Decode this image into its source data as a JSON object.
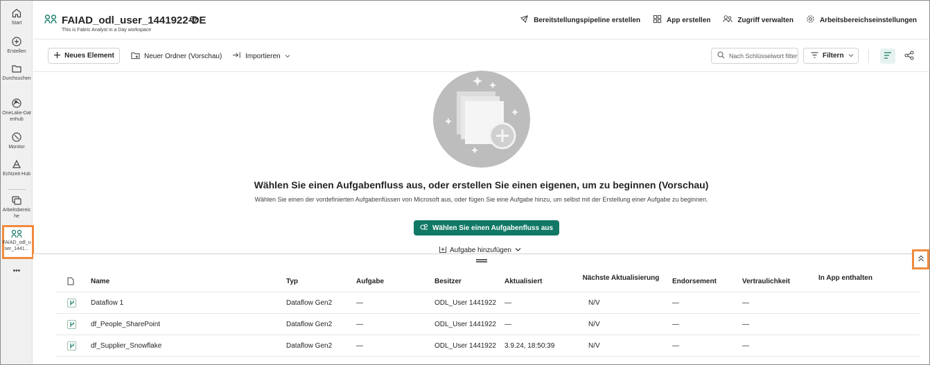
{
  "rail": {
    "items": [
      {
        "label": "Start",
        "icon": "home-icon"
      },
      {
        "label": "Erstellen",
        "icon": "create-icon"
      },
      {
        "label": "Durchsuchen",
        "icon": "folder-icon"
      },
      {
        "label": "OneLake-Datenhub",
        "icon": "onelake-icon"
      },
      {
        "label": "Monitor",
        "icon": "monitor-icon"
      },
      {
        "label": "Echtzeit-Hub",
        "icon": "realtime-icon"
      },
      {
        "label": "Arbeitsbereiche",
        "icon": "workspaces-icon"
      },
      {
        "label": "FAIAD_odl_user_1441...",
        "icon": "workspace-icon"
      }
    ],
    "more_label": "•••"
  },
  "header": {
    "title": "FAIAD_odl_user_1441922-DE",
    "subtitle": "This is Fabric Analyst in a Day workspace",
    "actions": [
      {
        "label": "Bereitstellungspipeline erstellen",
        "icon": "rocket-icon"
      },
      {
        "label": "App erstellen",
        "icon": "app-icon"
      },
      {
        "label": "Zugriff verwalten",
        "icon": "people-icon"
      },
      {
        "label": "Arbeitsbereichseinstellungen",
        "icon": "gear-icon"
      }
    ]
  },
  "toolbar": {
    "new_item": "Neues Element",
    "new_folder": "Neuer Ordner (Vorschau)",
    "import": "Importieren",
    "search_placeholder": "Nach Schlüsselwort filtern",
    "filter": "Filtern"
  },
  "empty_state": {
    "title": "Wählen Sie einen Aufgabenfluss aus, oder erstellen Sie einen eigenen, um zu beginnen (Vorschau)",
    "description": "Wählen Sie einen der vordefinierten Aufgabenfüssen von Microsoft aus, oder fügen Sie eine Aufgabe hinzu, um selbst mit der Erstellung einer Aufgabe zu beginnen.",
    "primary_button": "Wählen Sie einen Aufgabenfluss aus",
    "add_task": "Aufgabe hinzufügen"
  },
  "table": {
    "headers": {
      "name": "Name",
      "type": "Typ",
      "task": "Aufgabe",
      "owner": "Besitzer",
      "updated": "Aktualisiert",
      "next_refresh": "Nächste Aktualisierung",
      "endorsement": "Endorsement",
      "sensitivity": "Vertraulichkeit",
      "in_app": "In App enthalten"
    },
    "rows": [
      {
        "name": "Dataflow 1",
        "type": "Dataflow Gen2",
        "task": "—",
        "owner": "ODL_User 1441922",
        "updated": "—",
        "next_refresh": "N/V",
        "endorsement": "—",
        "sensitivity": "—"
      },
      {
        "name": "df_People_SharePoint",
        "type": "Dataflow Gen2",
        "task": "—",
        "owner": "ODL_User 1441922",
        "updated": "—",
        "next_refresh": "N/V",
        "endorsement": "—",
        "sensitivity": "—"
      },
      {
        "name": "df_Supplier_Snowflake",
        "type": "Dataflow Gen2",
        "task": "—",
        "owner": "ODL_User 1441922",
        "updated": "3.9.24, 18:50:39",
        "next_refresh": "N/V",
        "endorsement": "—",
        "sensitivity": "—"
      }
    ]
  },
  "colors": {
    "accent": "#117865",
    "highlight": "#f08a3c"
  }
}
